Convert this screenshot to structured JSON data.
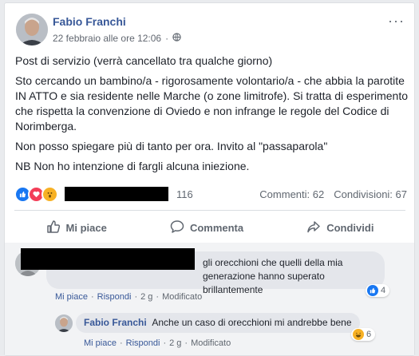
{
  "post": {
    "author": "Fabio Franchi",
    "timestamp": "22 febbraio alle ore 12:06",
    "privacy_icon": "globe-icon",
    "options_glyph": "···",
    "paragraphs": [
      "Post di servizio (verrà cancellato tra qualche giorno)",
      "Sto cercando un bambino/a - rigorosamente volontario/a - che abbia la parotite IN ATTO e sia residente nelle Marche (o zone limitrofe). Si tratta di esperimento che rispetta la convenzione di Oviedo e non infrange le regole del Codice di Norimberga.",
      "Non posso spiegare più di tanto per ora. Invito al \"passaparola\"",
      "NB Non ho intenzione di fargli alcuna iniezione."
    ]
  },
  "stats": {
    "reaction_count": "116",
    "comments": "Commenti: 62",
    "shares": "Condivisioni: 67",
    "reaction_icons": [
      "like-icon",
      "love-icon",
      "wow-icon"
    ]
  },
  "actions": {
    "like": "Mi piace",
    "comment": "Commenta",
    "share": "Condividi"
  },
  "comments": [
    {
      "text": "gli orecchioni che quelli della mia generazione hanno superato brillantemente",
      "like_label": "Mi piace",
      "reply_label": "Rispondi",
      "time": "2 g",
      "edited": "Modificato",
      "reaction_count": "4"
    },
    {
      "author": "Fabio Franchi",
      "text": "Anche un caso di orecchioni mi andrebbe bene",
      "like_label": "Mi piace",
      "reply_label": "Rispondi",
      "time": "2 g",
      "edited": "Modificato",
      "reaction_count": "6"
    }
  ],
  "colors": {
    "link": "#385898",
    "like_blue": "#1877f2",
    "love_red": "#f33e58",
    "wow_yellow": "#f7b125"
  }
}
